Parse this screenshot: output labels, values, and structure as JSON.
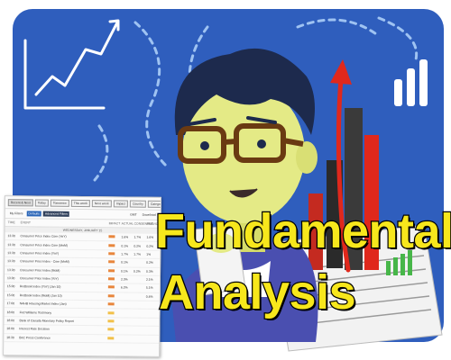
{
  "title": {
    "line1": "Fundamental",
    "line2": "Analysis"
  },
  "calendar": {
    "tabs": [
      "Recent & Next",
      "Today",
      "Tomorrow",
      "This week",
      "Next week"
    ],
    "filters": [
      "My Filters",
      "Defaults",
      "Advanced Filters"
    ],
    "controls": [
      "Impact",
      "Country",
      "Category",
      "GMT",
      "Download"
    ],
    "columns": [
      "TIME",
      "EVENT",
      "IMPACT",
      "ACTUAL",
      "CONSENSUS",
      "PREVIOUS"
    ],
    "day_label": "WEDNESDAY, JANUARY 15",
    "rows": [
      {
        "time": "13:30",
        "event": "Consumer Price Index Core (YoY)",
        "actual": "1.6%",
        "consensus": "1.7%",
        "previous": "1.6%"
      },
      {
        "time": "13:30",
        "event": "Consumer Price Index Core (MoM)",
        "actual": "0.1%",
        "consensus": "0.2%",
        "previous": "0.2%"
      },
      {
        "time": "13:30",
        "event": "Consumer Price Index (YoY)",
        "actual": "1.7%",
        "consensus": "1.7%",
        "previous": "1%"
      },
      {
        "time": "13:30",
        "event": "Consumer Price Index - Core (MoM)",
        "actual": "0.1%",
        "consensus": "",
        "previous": "0.2%"
      },
      {
        "time": "13:30",
        "event": "Consumer Price Index (MoM)",
        "actual": "0.1%",
        "consensus": "0.2%",
        "previous": "0.3%"
      },
      {
        "time": "13:30",
        "event": "Consumer Price Index (YoY)",
        "actual": "2.3%",
        "consensus": "",
        "previous": "2.1%"
      },
      {
        "time": "15:00",
        "event": "Redbook Index (YoY) (Jan 10)",
        "actual": "6.2%",
        "consensus": "",
        "previous": "5.1%"
      },
      {
        "time": "15:00",
        "event": "Redbook Index (MoM) (Jan 10)",
        "actual": "",
        "consensus": "",
        "previous": "0.4%"
      },
      {
        "time": "17:00",
        "event": "NAHB Housing Market Index (Jan)",
        "actual": "",
        "consensus": "",
        "previous": ""
      },
      {
        "time": "18:00",
        "event": "Fed Williams Testimony",
        "actual": "",
        "consensus": "",
        "previous": ""
      },
      {
        "time": "18:00",
        "event": "Bank of Canada Monetary Policy Report",
        "actual": "",
        "consensus": "",
        "previous": ""
      },
      {
        "time": "18:00",
        "event": "Interest Rate Decision",
        "actual": "",
        "consensus": "",
        "previous": ""
      },
      {
        "time": "18:30",
        "event": "BoC Press Conference",
        "actual": "",
        "consensus": "",
        "previous": ""
      }
    ]
  },
  "colors": {
    "background_blue": "#2f5ebd",
    "title_yellow": "#f7e71c",
    "arrow_red": "#e0281c",
    "bar_dark": "#2a2a2a",
    "hair_dark": "#1d2a4d",
    "skin": "#e4ea86"
  },
  "icons": [
    "line-chart-icon",
    "bar-chart-icon",
    "growth-arrow-icon",
    "character-illustration",
    "document-icon"
  ]
}
